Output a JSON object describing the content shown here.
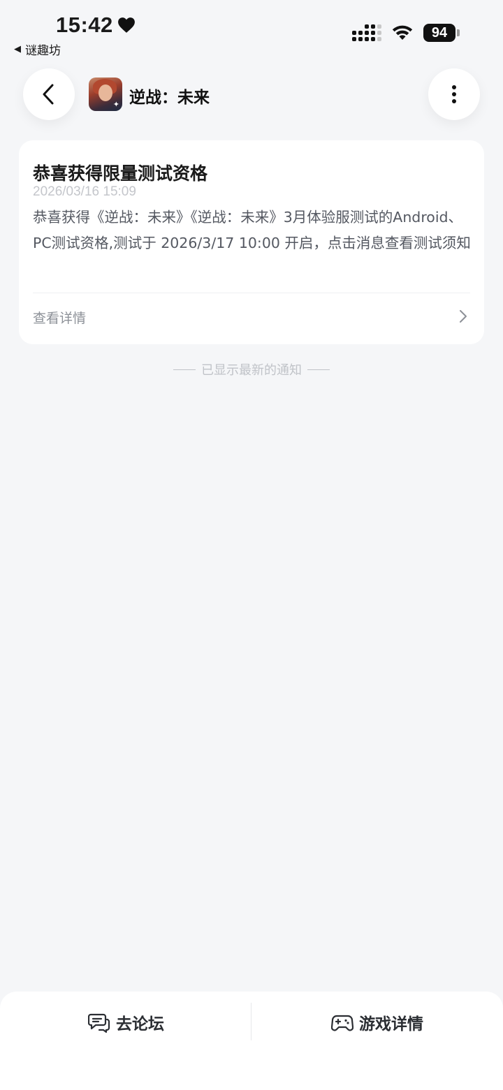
{
  "status_bar": {
    "time": "15:42",
    "back_app": "谜趣坊",
    "battery": "94"
  },
  "header": {
    "game_title": "逆战：未来"
  },
  "notification": {
    "title": "恭喜获得限量测试资格",
    "date": "2026/03/16 15:09",
    "body": "恭喜获得《逆战：未来》《逆战：未来》3月体验服测试的Android、PC测试资格,测试于 2026/3/17 10:00 开启，点击消息查看测试须知",
    "link_label": "查看详情"
  },
  "footer_notice": "已显示最新的通知",
  "bottom_bar": {
    "forum_label": "去论坛",
    "game_detail_label": "游戏详情"
  },
  "icons": {
    "heart": "heart-icon",
    "back": "chevron-left-icon",
    "more": "more-vertical-icon",
    "chevron": "chevron-right-icon",
    "forum": "chat-bubble-icon",
    "game": "gamepad-icon"
  }
}
